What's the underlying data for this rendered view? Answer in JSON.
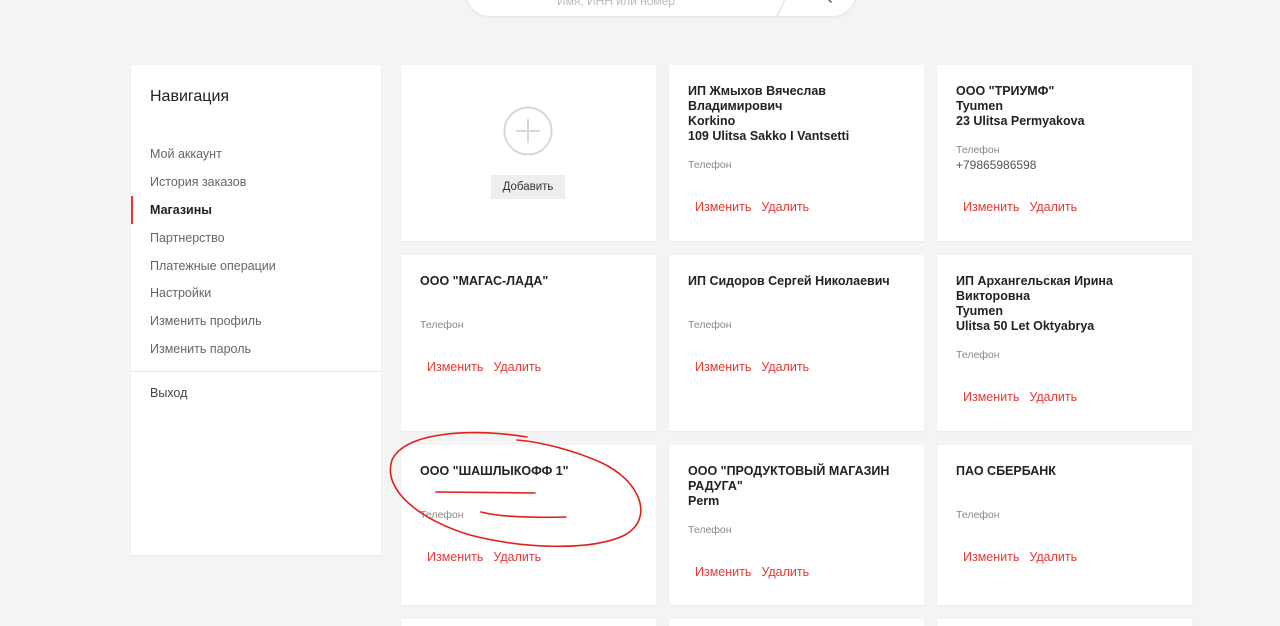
{
  "search": {
    "placeholder": "Имя, ИНН или номер"
  },
  "sidebar": {
    "title": "Навигация",
    "items": [
      {
        "label": "Мой аккаунт",
        "active": false
      },
      {
        "label": "История заказов",
        "active": false
      },
      {
        "label": "Магазины",
        "active": true
      },
      {
        "label": "Партнерство",
        "active": false
      },
      {
        "label": "Платежные операции",
        "active": false
      },
      {
        "label": "Настройки",
        "active": false
      },
      {
        "label": "Изменить профиль",
        "active": false
      },
      {
        "label": "Изменить пароль",
        "active": false
      }
    ],
    "exit_label": "Выход"
  },
  "add_card": {
    "button_label": "Добавить"
  },
  "cards": [
    {
      "title": [
        "ИП Жмыхов Вячеслав",
        "Владимирович",
        "Korkino",
        "109 Ulitsa Sakko I Vantsetti"
      ],
      "phone_label": "Телефон",
      "phone": "",
      "edit": "Изменить",
      "delete": "Удалить"
    },
    {
      "title": [
        "ООО \"ТРИУМФ\"",
        "Tyumen",
        "23 Ulitsa Permyakova"
      ],
      "phone_label": "Телефон",
      "phone": "+79865986598",
      "edit": "Изменить",
      "delete": "Удалить"
    },
    {
      "title": [
        "ООО \"МАГАС-ЛАДА\""
      ],
      "phone_label": "Телефон",
      "phone": "",
      "edit": "Изменить",
      "delete": "Удалить"
    },
    {
      "title": [
        "ИП Сидоров Сергей Николаевич"
      ],
      "phone_label": "Телефон",
      "phone": "",
      "edit": "Изменить",
      "delete": "Удалить"
    },
    {
      "title": [
        "ИП Архангельская Ирина",
        "Викторовна",
        "Tyumen",
        "Ulitsa 50 Let Oktyabrya"
      ],
      "phone_label": "Телефон",
      "phone": "",
      "edit": "Изменить",
      "delete": "Удалить"
    },
    {
      "title": [
        "ООО \"ШАШЛЫКОФФ 1\""
      ],
      "phone_label": "Телефон",
      "phone": "",
      "edit": "Изменить",
      "delete": "Удалить"
    },
    {
      "title": [
        "ООО \"ПРОДУКТОВЫЙ МАГАЗИН",
        "РАДУГА\"",
        "Perm"
      ],
      "phone_label": "Телефон",
      "phone": "",
      "edit": "Изменить",
      "delete": "Удалить"
    },
    {
      "title": [
        "ПАО СБЕРБАНК"
      ],
      "phone_label": "Телефон",
      "phone": "",
      "edit": "Изменить",
      "delete": "Удалить"
    }
  ],
  "colors": {
    "accent": "#e53935",
    "annotation": "#e0201a"
  }
}
